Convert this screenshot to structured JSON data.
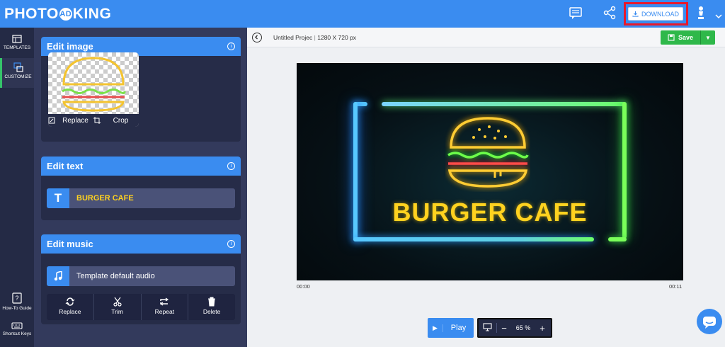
{
  "app": {
    "logo": "PHOTO",
    "logo_mark": "AD",
    "logo_tail": "KING"
  },
  "header": {
    "download_label": "DOWNLOAD"
  },
  "sidenav": {
    "templates_label": "TEMPLATES",
    "customize_label": "CUSTOMIZE",
    "howto_label": "How-To Guide",
    "shortcut_label": "Shortcut Keys"
  },
  "edit_image": {
    "title": "Edit image",
    "replace_label": "Replace",
    "crop_label": "Crop"
  },
  "edit_text": {
    "title": "Edit text",
    "text_value": "BURGER CAFE"
  },
  "edit_music": {
    "title": "Edit music",
    "audio_label": "Template default audio",
    "tools": [
      "Replace",
      "Trim",
      "Repeat",
      "Delete"
    ]
  },
  "editor": {
    "project_title": "Untitled Projec",
    "dimensions": "1280 X 720 px",
    "save_label": "Save",
    "canvas_text": "BURGER CAFE",
    "time_start": "00:00",
    "time_end": "00:11",
    "play_label": "Play",
    "zoom_minus": "−",
    "zoom_value": "65 %",
    "zoom_plus": "+"
  },
  "colors": {
    "accent": "#3a8cf0",
    "sidebar": "#242a45",
    "save_green": "#2fb84a",
    "highlight": "#e8192c",
    "neon_yellow": "#ffd21f"
  }
}
